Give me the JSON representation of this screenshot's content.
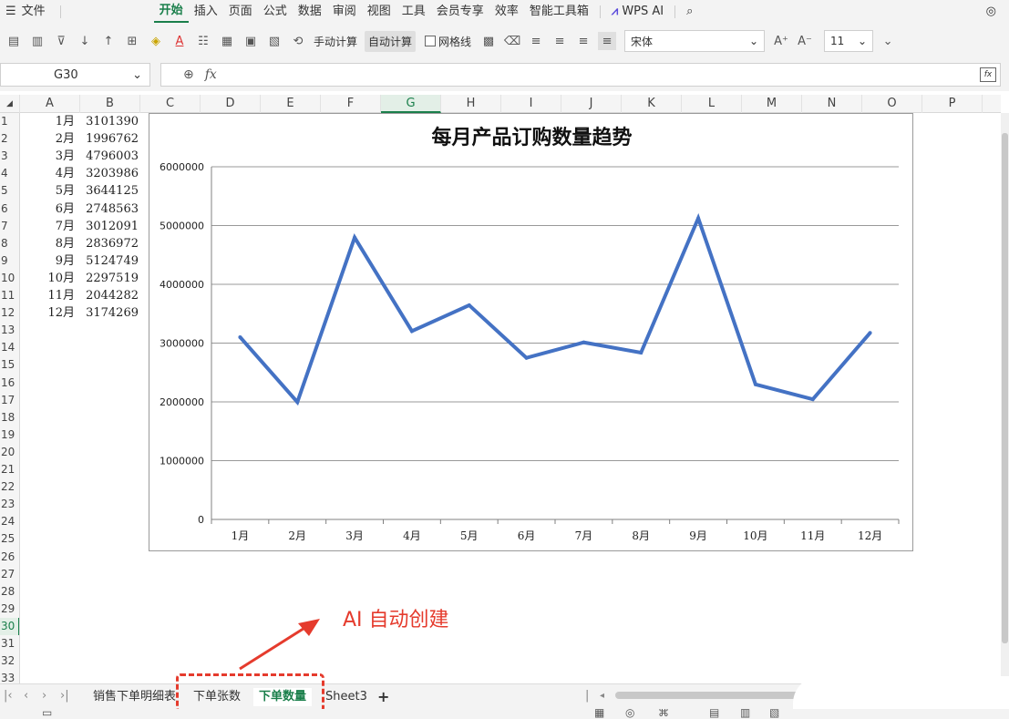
{
  "menubar": {
    "file_label": "文件",
    "tabs": [
      "开始",
      "插入",
      "页面",
      "公式",
      "数据",
      "审阅",
      "视图",
      "工具",
      "会员专享",
      "效率",
      "智能工具箱"
    ],
    "active_tab": "开始",
    "wps_ai_label": "WPS AI"
  },
  "toolbar": {
    "manual_calc_label": "手动计算",
    "auto_calc_label": "自动计算",
    "gridlines_label": "网格线",
    "font_name": "宋体",
    "font_size": "11"
  },
  "formula_bar": {
    "cell_reference": "G30",
    "fx_label": "fx",
    "formula_value": ""
  },
  "grid": {
    "columns": [
      "A",
      "B",
      "C",
      "D",
      "E",
      "F",
      "G",
      "H",
      "I",
      "J",
      "K",
      "L",
      "M",
      "N",
      "O",
      "P"
    ],
    "selected_column": "G",
    "rows": [
      "1",
      "2",
      "3",
      "4",
      "5",
      "6",
      "7",
      "8",
      "9",
      "10",
      "11",
      "12",
      "13",
      "14",
      "15",
      "16",
      "17",
      "18",
      "19",
      "20",
      "21",
      "22",
      "23",
      "24",
      "25",
      "26",
      "27",
      "28",
      "29",
      "30",
      "31",
      "32",
      "33"
    ],
    "selected_row": "30",
    "data": [
      {
        "month": "1月",
        "value": "3101390"
      },
      {
        "month": "2月",
        "value": "1996762"
      },
      {
        "month": "3月",
        "value": "4796003"
      },
      {
        "month": "4月",
        "value": "3203986"
      },
      {
        "month": "5月",
        "value": "3644125"
      },
      {
        "month": "6月",
        "value": "2748563"
      },
      {
        "month": "7月",
        "value": "3012091"
      },
      {
        "month": "8月",
        "value": "2836972"
      },
      {
        "month": "9月",
        "value": "5124749"
      },
      {
        "month": "10月",
        "value": "2297519"
      },
      {
        "month": "11月",
        "value": "2044282"
      },
      {
        "month": "12月",
        "value": "3174269"
      }
    ]
  },
  "chart_data": {
    "type": "line",
    "title": "每月产品订购数量趋势",
    "categories": [
      "1月",
      "2月",
      "3月",
      "4月",
      "5月",
      "6月",
      "7月",
      "8月",
      "9月",
      "10月",
      "11月",
      "12月"
    ],
    "values": [
      3101390,
      1996762,
      4796003,
      3203986,
      3644125,
      2748563,
      3012091,
      2836972,
      5124749,
      2297519,
      2044282,
      3174269
    ],
    "ylim": [
      0,
      6000000
    ],
    "yticks": [
      "0",
      "1000000",
      "2000000",
      "3000000",
      "4000000",
      "5000000",
      "6000000"
    ],
    "xlabel": "",
    "ylabel": "",
    "grid": true,
    "legend": "none",
    "line_color": "#4472c4"
  },
  "annotation": {
    "text": "AI 自动创建",
    "color": "#e53b2d"
  },
  "sheet_tabs": {
    "tabs": [
      "销售下单明细表",
      "下单张数",
      "下单数量",
      "Sheet3"
    ],
    "active": "下单数量",
    "add_label": "+"
  },
  "colors": {
    "accent": "#1a7f4b",
    "highlight": "#e53b2d"
  }
}
